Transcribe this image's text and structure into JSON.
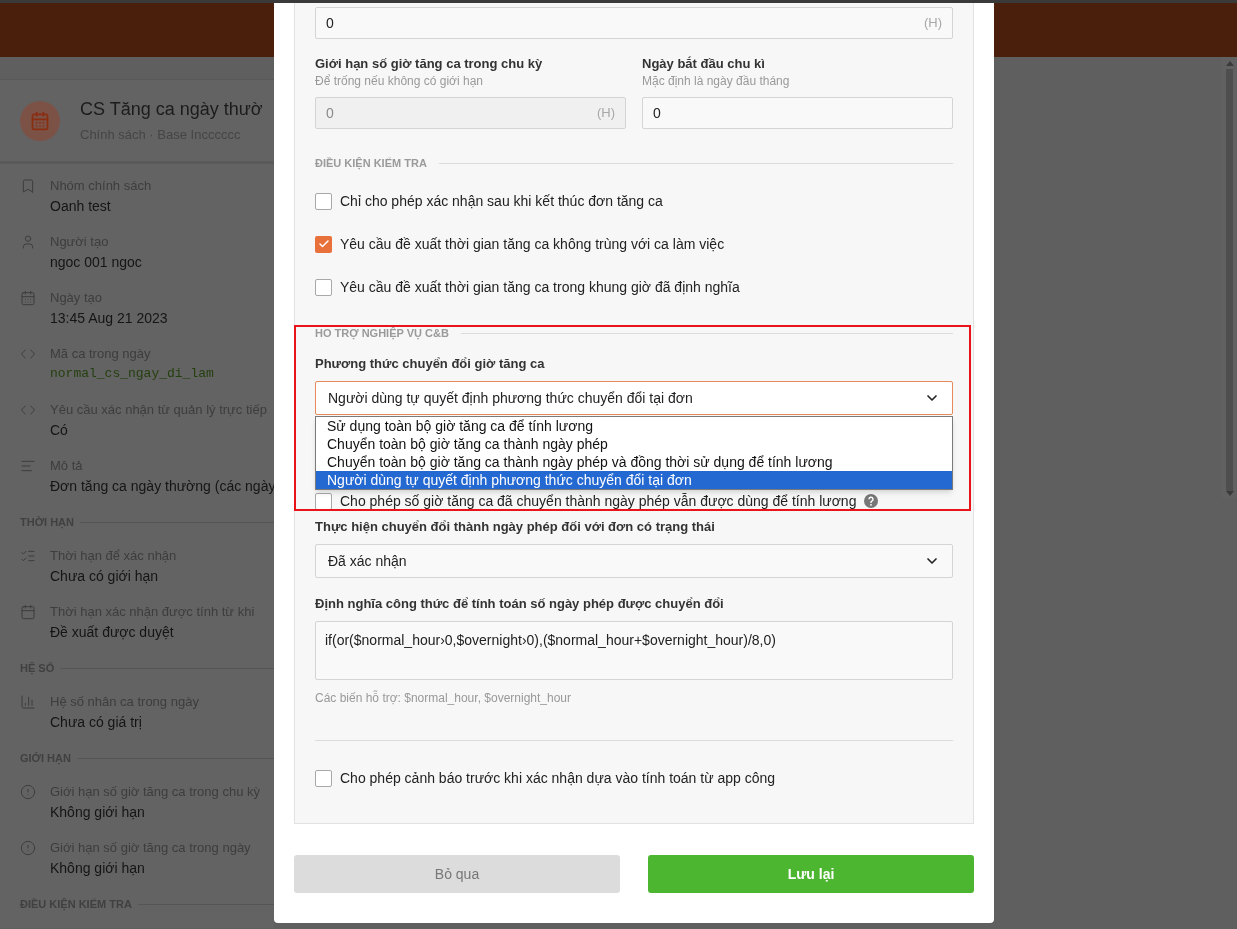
{
  "background": {
    "policy": {
      "title": "CS Tăng ca ngày thườ",
      "subtitle": "Chính sách · Base Incccccc"
    },
    "sections": [
      {
        "items": [
          {
            "label": "Nhóm chính sách",
            "value": "Oanh test",
            "kind": "text"
          },
          {
            "label": "Người tạo",
            "value": "ngoc 001 ngoc",
            "kind": "text"
          },
          {
            "label": "Ngày tạo",
            "value": "13:45 Aug 21 2023",
            "kind": "text"
          },
          {
            "label": "Mã ca trong ngày",
            "value": "normal_cs_ngay_di_lam",
            "kind": "code"
          },
          {
            "label": "Yêu cầu xác nhận từ quản lý trực tiếp",
            "value": "Có",
            "kind": "text"
          },
          {
            "label": "Mô tả",
            "value": "Đơn tăng ca ngày thường (các ngày",
            "kind": "text"
          }
        ]
      },
      {
        "heading": "THỜI HẠN",
        "items": [
          {
            "label": "Thời hạn để xác nhận",
            "value": "Chưa có giới hạn",
            "kind": "text"
          },
          {
            "label": "Thời hạn xác nhận được tính từ khi",
            "value": "Đề xuất được duyệt",
            "kind": "text"
          }
        ]
      },
      {
        "heading": "HỆ SỐ",
        "items": [
          {
            "label": "Hệ số nhân ca trong ngày",
            "value": "Chưa có giá trị",
            "kind": "text"
          }
        ]
      },
      {
        "heading": "GIỚI HẠN",
        "items": [
          {
            "label": "Giới hạn số giờ tăng ca trong chu kỳ",
            "value": "Không giới hạn",
            "kind": "text"
          },
          {
            "label": "Giới hạn số giờ tăng ca trong ngày",
            "value": "Không giới hạn",
            "kind": "text"
          }
        ]
      },
      {
        "heading": "ĐIỀU KIỆN KIỂM TRA"
      }
    ]
  },
  "modal": {
    "daily_limit_field": {
      "value": "0",
      "unit": "(H)"
    },
    "cycle_limit": {
      "label": "Giới hạn số giờ tăng ca trong chu kỳ",
      "hint": "Để trống nếu không có giới hạn",
      "value": "0",
      "unit": "(H)",
      "disabled": true
    },
    "cycle_start": {
      "label": "Ngày bắt đầu chu kì",
      "hint": "Mặc định là ngày đầu tháng",
      "value": "0"
    },
    "check_conditions": {
      "heading": "ĐIỀU KIỆN KIỂM TRA",
      "options": [
        {
          "label": "Chỉ cho phép xác nhận sau khi kết thúc đơn tăng ca",
          "checked": false
        },
        {
          "label": "Yêu cầu đề xuất thời gian tăng ca không trùng với ca làm việc",
          "checked": true
        },
        {
          "label": "Yêu cầu đề xuất thời gian tăng ca trong khung giờ đã định nghĩa",
          "checked": false
        }
      ]
    },
    "cb_support": {
      "heading": "HO TRỢ NGHIỆP VỤ C&B",
      "conversion_method": {
        "label": "Phương thức chuyển đổi giờ tăng ca",
        "value": "Người dùng tự quyết định phương thức chuyển đổi tại đơn",
        "expanded": true,
        "options": [
          {
            "label": "Sử dụng toàn bộ giờ tăng ca để tính lương",
            "selected": false
          },
          {
            "label": "Chuyển toàn bộ giờ tăng ca thành ngày phép",
            "selected": false
          },
          {
            "label": "Chuyển toàn bộ giờ tăng ca thành ngày phép và đồng thời sử dụng để tính lương",
            "selected": false
          },
          {
            "label": "Người dùng tự quyết định phương thức chuyển đổi tại đơn",
            "selected": true
          }
        ]
      },
      "reuse_option": {
        "label": "Cho phép số giờ tăng ca đã chuyển thành ngày phép vẫn được dùng để tính lương",
        "checked": false
      },
      "status_select": {
        "label": "Thực hiện chuyển đổi thành ngày phép đối với đơn có trạng thái",
        "value": "Đã xác nhận"
      },
      "formula": {
        "label": "Định nghĩa công thức để tính toán số ngày phép được chuyển đổi",
        "value": "if(or($normal_hour›0,$overnight›0),($normal_hour+$overnight_hour)/8,0)",
        "hint": "Các biến hỗ trợ: $normal_hour, $overnight_hour"
      },
      "warning_option": {
        "label": "Cho phép cảnh báo trước khi xác nhận dựa vào tính toán từ app công",
        "checked": false
      }
    },
    "buttons": {
      "cancel": "Bỏ qua",
      "save": "Lưu lại"
    }
  }
}
